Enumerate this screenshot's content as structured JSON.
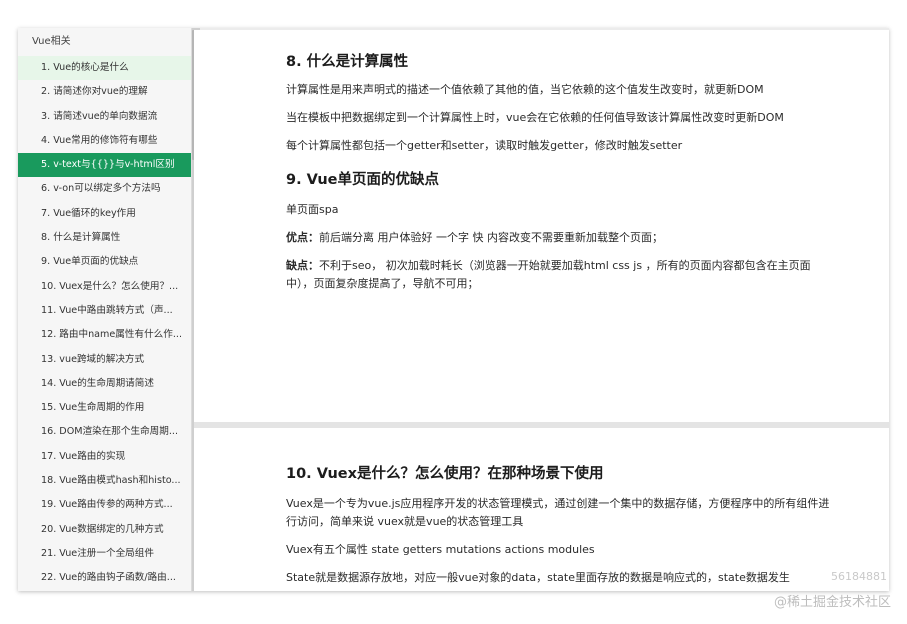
{
  "sidebar": {
    "title": "Vue相关",
    "items": [
      {
        "label": "1. Vue的核心是什么"
      },
      {
        "label": "2. 请简述你对vue的理解"
      },
      {
        "label": "3. 请简述vue的单向数据流"
      },
      {
        "label": "4. Vue常用的修饰符有哪些"
      },
      {
        "label": "5. v-text与{{}}与v-html区别"
      },
      {
        "label": "6. v-on可以绑定多个方法吗"
      },
      {
        "label": "7. Vue循环的key作用"
      },
      {
        "label": "8. 什么是计算属性"
      },
      {
        "label": "9. Vue单页面的优缺点"
      },
      {
        "label": "10. Vuex是什么？怎么使用？..."
      },
      {
        "label": "11. Vue中路由跳转方式（声..."
      },
      {
        "label": "12. 路由中name属性有什么作..."
      },
      {
        "label": "13. vue跨域的解决方式"
      },
      {
        "label": "14. Vue的生命周期请简述"
      },
      {
        "label": "15. Vue生命周期的作用"
      },
      {
        "label": "16. DOM渲染在那个生命周期..."
      },
      {
        "label": "17. Vue路由的实现"
      },
      {
        "label": "18. Vue路由模式hash和histo..."
      },
      {
        "label": "19. Vue路由传参的两种方式..."
      },
      {
        "label": "20. Vue数据绑定的几种方式"
      },
      {
        "label": "21. Vue注册一个全局组件"
      },
      {
        "label": "22. Vue的路由钩子函数/路由..."
      }
    ]
  },
  "section8": {
    "title": "8. 什么是计算属性",
    "p1": "计算属性是用来声明式的描述一个值依赖了其他的值，当它依赖的这个值发生改变时，就更新DOM",
    "p2": "当在模板中把数据绑定到一个计算属性上时，vue会在它依赖的任何值导致该计算属性改变时更新DOM",
    "p3": "每个计算属性都包括一个getter和setter，读取时触发getter，修改时触发setter"
  },
  "section9": {
    "title": "9. Vue单页面的优缺点",
    "p1": "单页面spa",
    "pros_label": "优点：",
    "pros_text": "前后端分离 用户体验好 一个字 快 内容改变不需要重新加载整个页面；",
    "cons_label": "缺点：",
    "cons_text": "不利于seo， 初次加载时耗长（浏览器一开始就要加载html css js ，所有的页面内容都包含在主页面中），页面复杂度提高了，导航不可用；"
  },
  "section10": {
    "title": "10. Vuex是什么？怎么使用？在那种场景下使用",
    "p1": "Vuex是一个专为vue.js应用程序开发的状态管理模式，通过创建一个集中的数据存储，方便程序中的所有组件进行访问，简单来说 vuex就是vue的状态管理工具",
    "p2": "Vuex有五个属性 state getters mutations actions modules",
    "p3": "State就是数据源存放地，对应一般vue对象的data，state里面存放的数据是响应式的，state数据发生"
  },
  "watermark": {
    "text": "@稀土掘金技术社区",
    "id": "56184881"
  }
}
